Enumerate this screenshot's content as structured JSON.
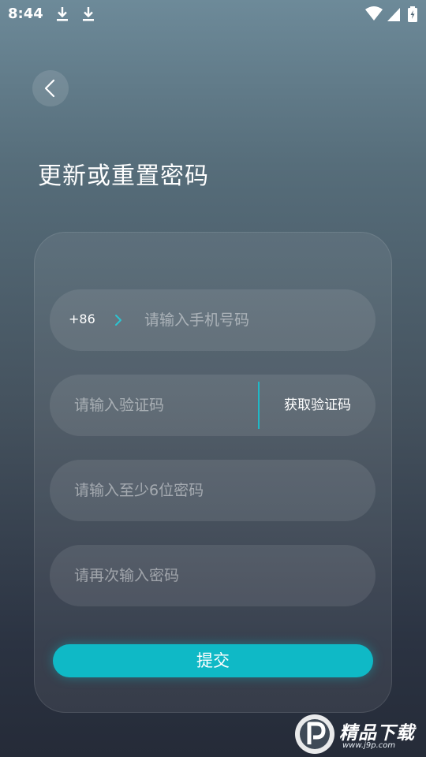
{
  "status_bar": {
    "time": "8:44",
    "left_icons": [
      "download-icon",
      "download-icon"
    ],
    "right_icons": [
      "wifi-icon",
      "cellular-signal-icon",
      "battery-charging-icon"
    ]
  },
  "header": {
    "back_icon": "chevron-left-icon",
    "title": "更新或重置密码"
  },
  "form": {
    "phone": {
      "country_code": "+86",
      "chevron_icon": "chevron-right-icon",
      "placeholder": "请输入手机号码",
      "value": ""
    },
    "verification": {
      "placeholder": "请输入验证码",
      "value": "",
      "get_code_label": "获取验证码"
    },
    "password": {
      "placeholder": "请输入至少6位密码",
      "value": ""
    },
    "confirm_password": {
      "placeholder": "请再次输入密码",
      "value": ""
    },
    "submit_label": "提交"
  },
  "watermark": {
    "text": "精品下载",
    "url": "www.j9p.com"
  },
  "colors": {
    "accent": "#0fb9c6",
    "divider": "#1fb8c7",
    "chevron": "#2cc4d1"
  }
}
